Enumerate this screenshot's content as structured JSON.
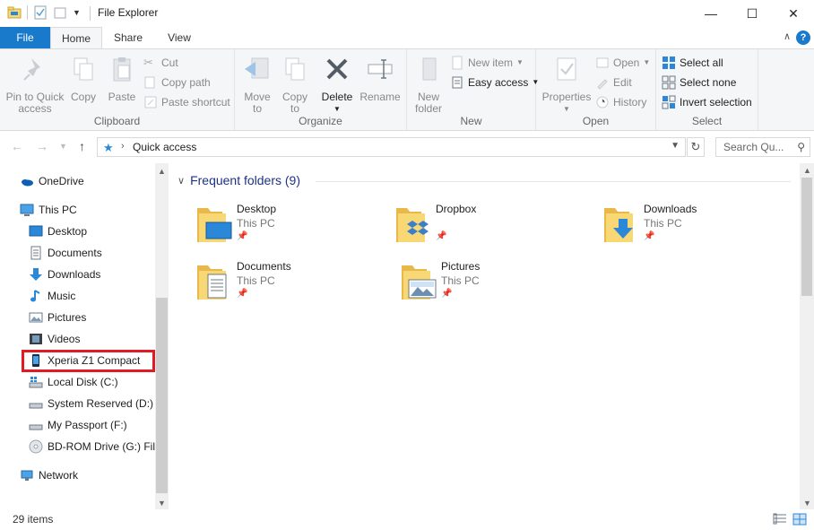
{
  "window": {
    "title": "File Explorer"
  },
  "titlebar": {
    "minimize_icon": "minimize-icon",
    "maximize_icon": "maximize-icon",
    "close_icon": "close-icon"
  },
  "ribbon_tabs": {
    "file": "File",
    "home": "Home",
    "share": "Share",
    "view": "View"
  },
  "ribbon": {
    "clipboard": {
      "label": "Clipboard",
      "pin": "Pin to Quick\naccess",
      "copy": "Copy",
      "paste": "Paste",
      "cut": "Cut",
      "copy_path": "Copy path",
      "paste_shortcut": "Paste shortcut"
    },
    "organize": {
      "label": "Organize",
      "move_to": "Move\nto",
      "copy_to": "Copy\nto",
      "delete": "Delete",
      "rename": "Rename"
    },
    "new": {
      "label": "New",
      "new_folder": "New\nfolder",
      "new_item": "New item",
      "easy_access": "Easy access"
    },
    "open": {
      "label": "Open",
      "properties": "Properties",
      "open": "Open",
      "edit": "Edit",
      "history": "History"
    },
    "select": {
      "label": "Select",
      "select_all": "Select all",
      "select_none": "Select none",
      "invert": "Invert selection"
    }
  },
  "address": {
    "path": "Quick access",
    "search_placeholder": "Search Qu..."
  },
  "nav": {
    "onedrive": "OneDrive",
    "this_pc": "This PC",
    "desktop": "Desktop",
    "documents": "Documents",
    "downloads": "Downloads",
    "music": "Music",
    "pictures": "Pictures",
    "videos": "Videos",
    "xperia": "Xperia Z1 Compact",
    "local_disk": "Local Disk (C:)",
    "system_reserved": "System Reserved (D:)",
    "my_passport": "My Passport (F:)",
    "bd_rom": "BD-ROM Drive (G:) File",
    "network": "Network"
  },
  "content": {
    "section_title": "Frequent folders (9)",
    "folders": [
      {
        "name": "Desktop",
        "location": "This PC"
      },
      {
        "name": "Dropbox",
        "location": ""
      },
      {
        "name": "Downloads",
        "location": "This PC"
      },
      {
        "name": "Documents",
        "location": "This PC"
      },
      {
        "name": "Pictures",
        "location": "This PC"
      }
    ]
  },
  "status": {
    "count": "29 items"
  },
  "colors": {
    "accent": "#1979ca",
    "highlight_border": "#e01b24",
    "folder": "#f8d775"
  }
}
